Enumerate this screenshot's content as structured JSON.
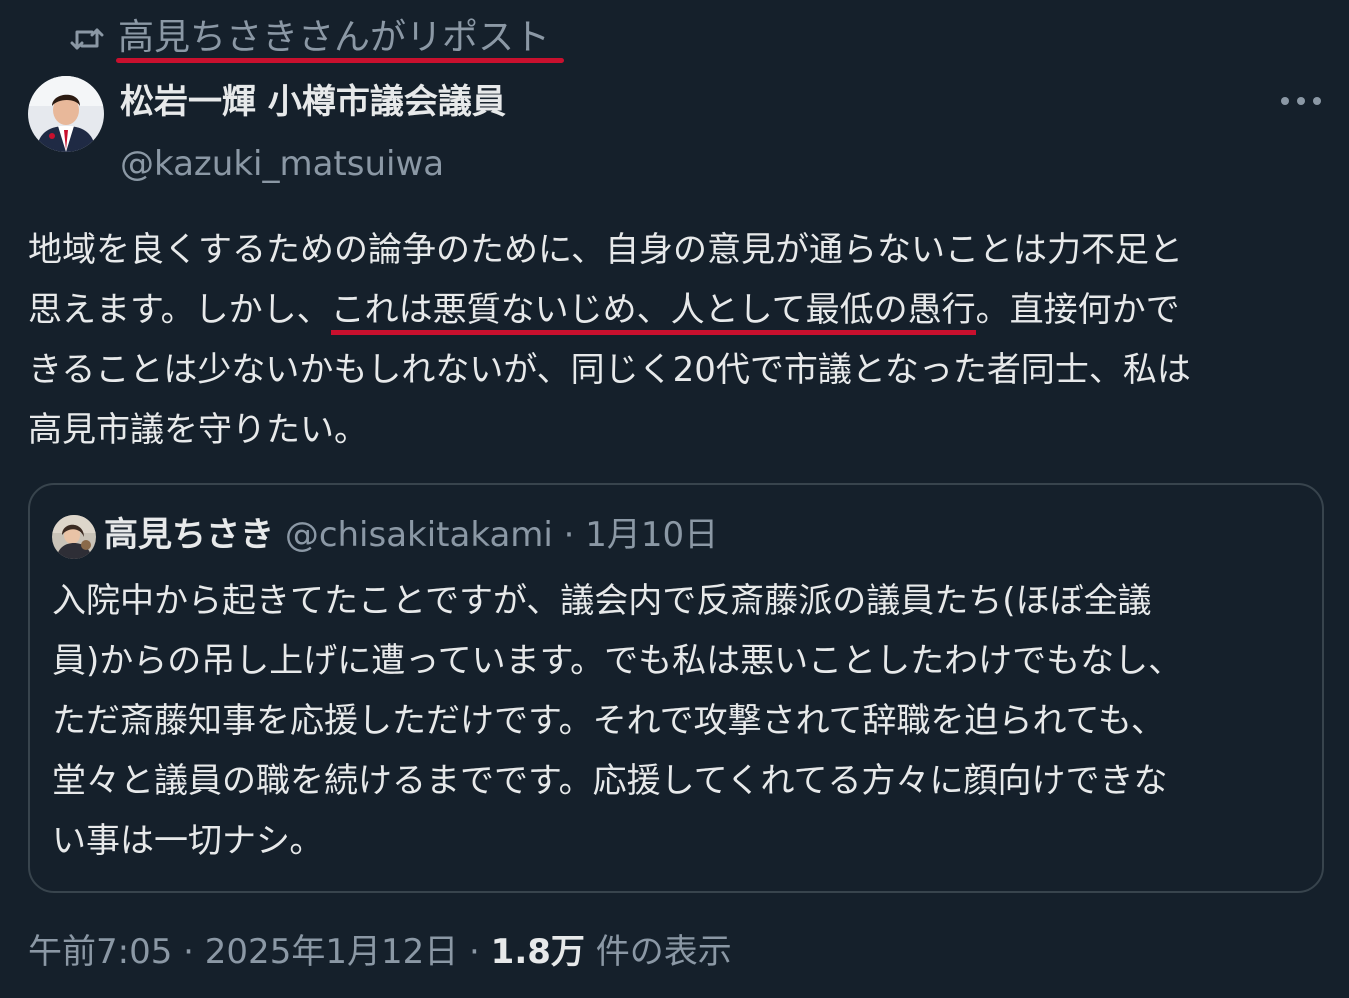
{
  "repost": {
    "icon": "repost-icon",
    "text": "高見ちさきさんがリポスト",
    "highlight_color": "#c8102e"
  },
  "author": {
    "name": "松岩一輝 小樽市議会議員",
    "handle": "@kazuki_matsuiwa"
  },
  "tweet": {
    "line1": "地域を良くするための論争のために、自身の意見が通らないことは力不足と",
    "line2_pre": "思えます。しかし、",
    "line2_highlight": "これは悪質ないじめ、人として最低の愚行",
    "line2_post": "。直接何かで",
    "line3": "きることは少ないかもしれないが、同じく20代で市議となった者同士、私は",
    "line4": "高見市議を守りたい。"
  },
  "quote": {
    "name": "高見ちさき",
    "handle": "@chisakitakami",
    "separator": "·",
    "date": "1月10日",
    "lines": [
      "入院中から起きてたことですが、議会内で反斎藤派の議員たち(ほぼ全議",
      "員)からの吊し上げに遭っています。でも私は悪いことしたわけでもなし、",
      "ただ斎藤知事を応援しただけです。それで攻撃されて辞職を迫られても、",
      "堂々と議員の職を続けるまでです。応援してくれてる方々に顔向けできな",
      "い事は一切ナシ。"
    ]
  },
  "meta": {
    "time": "午前7:05",
    "dot1": "·",
    "date": "2025年1月12日",
    "dot2": "·",
    "views": "1.8万",
    "views_label": "件の表示"
  },
  "colors": {
    "background": "#15202b",
    "text": "#e7e9ea",
    "muted": "#8b98a5",
    "border": "#38444d"
  }
}
